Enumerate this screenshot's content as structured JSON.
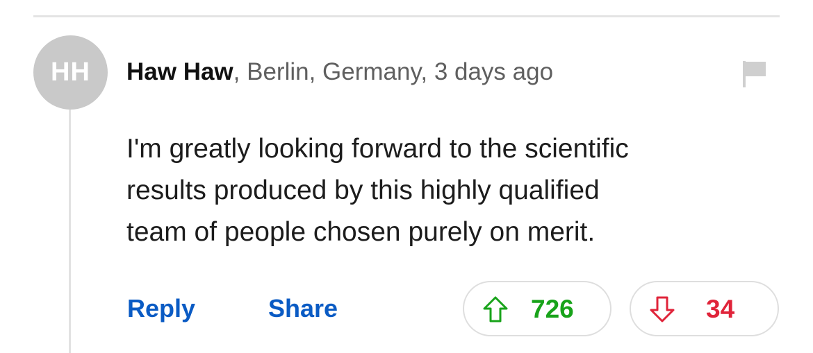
{
  "comment": {
    "avatar_initials": "HH",
    "author": "Haw Haw",
    "location_time": ", Berlin, Germany, 3 days ago",
    "text": "I'm greatly looking forward to the scientific\nresults produced by this highly qualified\nteam of people chosen purely on merit.",
    "actions": {
      "reply_label": "Reply",
      "share_label": "Share"
    },
    "votes": {
      "up_count": "726",
      "down_count": "34"
    },
    "icons": {
      "flag": "flag-icon",
      "upvote": "arrow-up-icon",
      "downvote": "arrow-down-icon"
    },
    "colors": {
      "link": "#0a5bc4",
      "upvote": "#18a31a",
      "downvote": "#e0243a",
      "avatar_bg": "#c9c9c9"
    }
  }
}
